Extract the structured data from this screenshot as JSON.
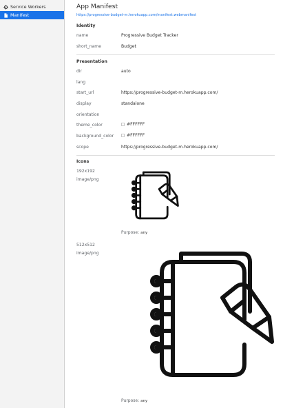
{
  "sidebar": {
    "items": [
      {
        "label": "Service Workers",
        "icon": "gear-icon",
        "active": false
      },
      {
        "label": "Manifest",
        "icon": "document-icon",
        "active": true
      }
    ]
  },
  "header": {
    "title": "App Manifest",
    "manifest_url": "https://progressive-budget-m.herokuapp.com/manifest.webmanifest"
  },
  "identity": {
    "heading": "Identity",
    "rows": [
      {
        "label": "name",
        "value": "Progressive Budget Tracker"
      },
      {
        "label": "short_name",
        "value": "Budget"
      }
    ]
  },
  "presentation": {
    "heading": "Presentation",
    "rows": [
      {
        "label": "dir",
        "value": "auto"
      },
      {
        "label": "lang",
        "value": ""
      },
      {
        "label": "start_url",
        "value": "https://progressive-budget-m.herokuapp.com/"
      },
      {
        "label": "display",
        "value": "standalone"
      },
      {
        "label": "orientation",
        "value": ""
      },
      {
        "label": "theme_color",
        "value": "#FFFFFF"
      },
      {
        "label": "background_color",
        "value": "#FFFFFF"
      },
      {
        "label": "scope",
        "value": "https://progressive-budget-m.herokuapp.com/"
      }
    ]
  },
  "icons": {
    "heading": "Icons",
    "purpose_label": "Purpose:",
    "items": [
      {
        "size": "192x192",
        "type": "image/png",
        "purpose": "any",
        "icon": "notebook-pencil-icon"
      },
      {
        "size": "512x512",
        "type": "image/png",
        "purpose": "any",
        "icon": "notebook-pencil-icon"
      }
    ]
  },
  "colors": {
    "accent": "#1a73e8",
    "swatch": "#FFFFFF"
  }
}
